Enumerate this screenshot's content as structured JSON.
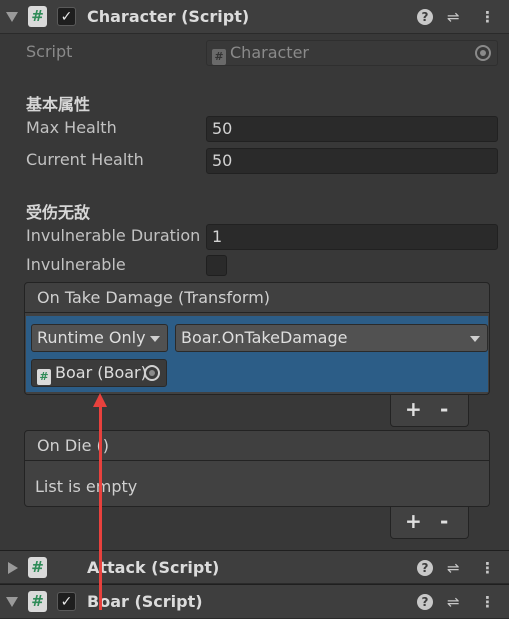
{
  "components": [
    {
      "title": "Character (Script)",
      "expanded": true,
      "enabled": true
    },
    {
      "title": "Attack (Script)",
      "expanded": false,
      "enabled": null
    },
    {
      "title": "Boar (Script)",
      "expanded": true,
      "enabled": true
    }
  ],
  "character": {
    "script_label": "Script",
    "script_value": "Character",
    "section_basic": "基本属性",
    "max_health_label": "Max Health",
    "max_health_value": "50",
    "current_health_label": "Current Health",
    "current_health_value": "50",
    "section_invuln": "受伤无敌",
    "invuln_duration_label": "Invulnerable Duration",
    "invuln_duration_value": "1",
    "invulnerable_label": "Invulnerable",
    "invulnerable_checked": false
  },
  "on_take_damage": {
    "header": "On Take Damage (Transform)",
    "runtime_mode": "Runtime Only",
    "function": "Boar.OnTakeDamage",
    "target_object": "Boar (Boar)",
    "plus": "+",
    "minus": "-"
  },
  "on_die": {
    "header": "On Die ()",
    "empty_text": "List is empty",
    "plus": "+",
    "minus": "-"
  },
  "icons": {
    "help": "?",
    "settings": "⇌",
    "menu": "⋮",
    "check": "✓",
    "hash": "#"
  },
  "colors": {
    "background": "#383838",
    "header": "#3e3e3e",
    "selection": "#2c5d87",
    "annotation_arrow": "#e8413d"
  }
}
